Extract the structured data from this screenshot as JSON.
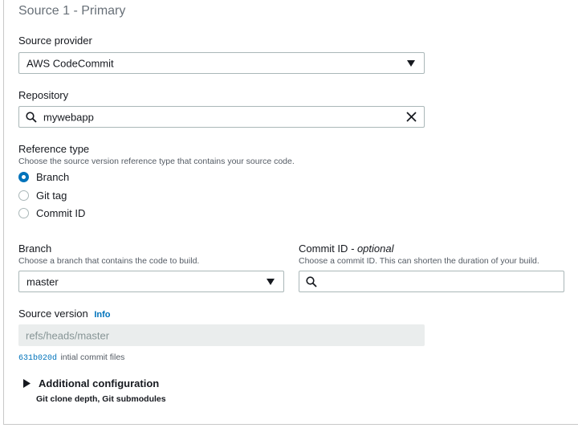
{
  "section": {
    "title": "Source 1 - Primary"
  },
  "source_provider": {
    "label": "Source provider",
    "value": "AWS CodeCommit"
  },
  "repository": {
    "label": "Repository",
    "value": "mywebapp"
  },
  "reference_type": {
    "label": "Reference type",
    "description": "Choose the source version reference type that contains your source code.",
    "options": [
      {
        "label": "Branch",
        "selected": true
      },
      {
        "label": "Git tag",
        "selected": false
      },
      {
        "label": "Commit ID",
        "selected": false
      }
    ]
  },
  "branch": {
    "label": "Branch",
    "description": "Choose a branch that contains the code to build.",
    "value": "master"
  },
  "commit_id": {
    "label": "Commit ID",
    "optional": "- optional",
    "description": "Choose a commit ID. This can shorten the duration of your build.",
    "value": ""
  },
  "source_version": {
    "label": "Source version",
    "info": "Info",
    "value": "refs/heads/master",
    "commit_hash": "631b020d",
    "commit_message": "intial commit files"
  },
  "additional_configuration": {
    "label": "Additional configuration",
    "description": "Git clone depth, Git submodules"
  },
  "colors": {
    "accent": "#0073bb",
    "text": "#16191f",
    "muted": "#545b64",
    "disabled_bg": "#eaeded"
  },
  "icons": [
    "search-icon",
    "clear-icon",
    "dropdown-icon",
    "caret-right-icon"
  ]
}
